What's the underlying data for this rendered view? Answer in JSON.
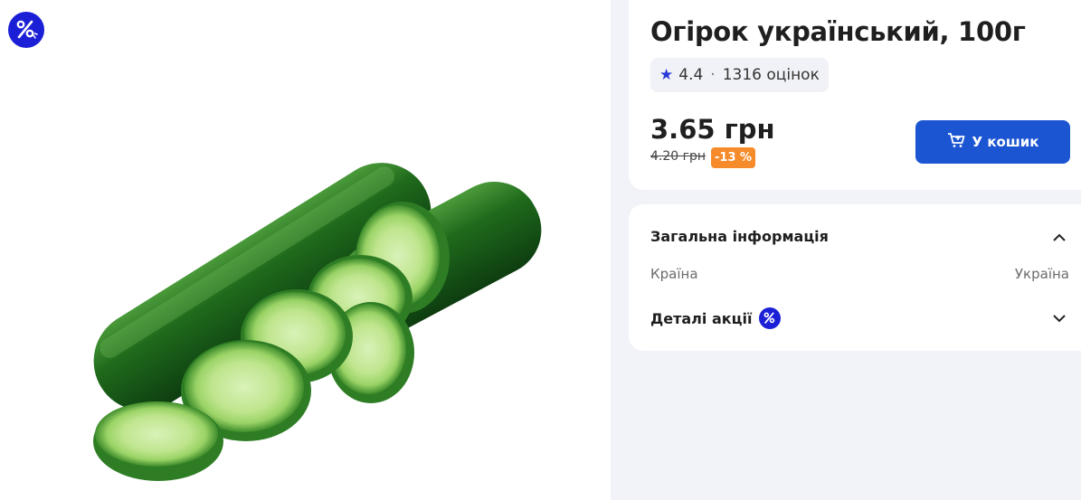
{
  "product": {
    "title": "Огірок український, 100г",
    "image_alt": "cucumber-image"
  },
  "rating": {
    "score": "4.4",
    "separator": "·",
    "count_text": "1316 оцінок",
    "icon": "star-icon"
  },
  "pricing": {
    "price": "3.65 грн",
    "old_price": "4.20 грн",
    "discount": "-13 %"
  },
  "cart_button": {
    "label": "У кошик",
    "icon": "cart-icon"
  },
  "general_info": {
    "title": "Загальна інформація",
    "rows": [
      {
        "label": "Країна",
        "value": "Україна"
      }
    ]
  },
  "promo_details": {
    "title": "Деталі акції"
  },
  "colors": {
    "accent_blue": "#1b55d2",
    "promo_blue": "#1b1fd6",
    "discount_orange": "#f58b2a"
  }
}
